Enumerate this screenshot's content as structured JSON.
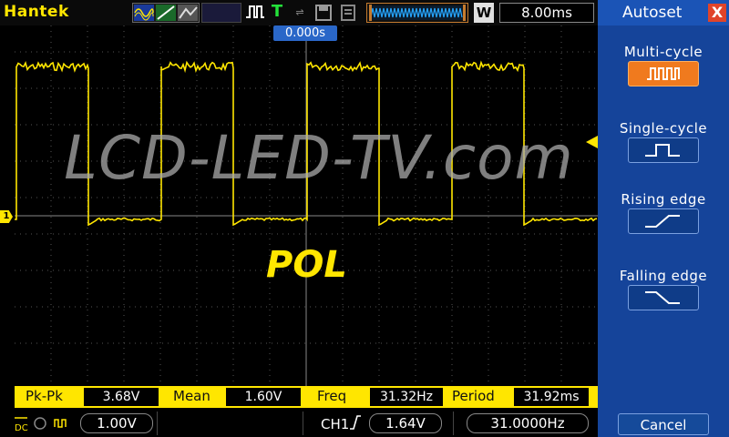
{
  "header": {
    "brand": "Hantek",
    "w_badge": "W",
    "timebase": "8.00ms"
  },
  "display": {
    "time_offset": "0.000s",
    "watermark": "LCD-LED-TV.com",
    "signal_label": "POL",
    "ch1_marker": "1",
    "trace_color": "#ffe600"
  },
  "measurements": [
    {
      "label": "Pk-Pk",
      "value": "3.68V"
    },
    {
      "label": "Mean",
      "value": "1.60V"
    },
    {
      "label": "Freq",
      "value": "31.32Hz"
    },
    {
      "label": "Period",
      "value": "31.92ms"
    }
  ],
  "bottom": {
    "volts_div": "1.00V",
    "channel": "CH1",
    "trigger_level": "1.64V",
    "trigger_freq": "31.0000Hz"
  },
  "panel": {
    "title": "Autoset",
    "close": "X",
    "options": [
      {
        "label": "Multi-cycle",
        "icon": "multi-cycle-icon",
        "active": true
      },
      {
        "label": "Single-cycle",
        "icon": "single-cycle-icon",
        "active": false
      },
      {
        "label": "Rising edge",
        "icon": "rising-edge-icon",
        "active": false
      },
      {
        "label": "Falling edge",
        "icon": "falling-edge-icon",
        "active": false
      }
    ],
    "cancel": "Cancel"
  }
}
